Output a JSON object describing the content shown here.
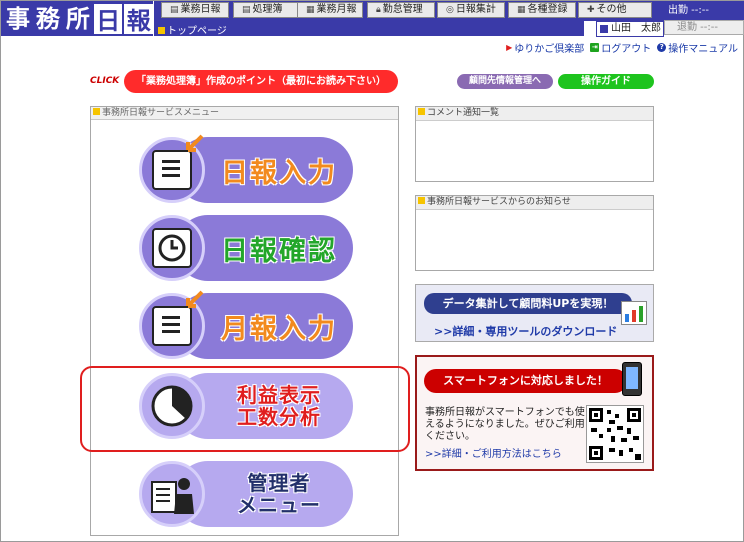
{
  "header": {
    "logo_chars": [
      "事",
      "務",
      "所",
      "日",
      "報"
    ],
    "nav": [
      {
        "icon": "list-icon",
        "label": "業務日報"
      },
      {
        "icon": "list-icon",
        "label": "処理簿"
      },
      {
        "icon": "calendar-icon",
        "label": "業務月報"
      },
      {
        "icon": "lock-icon",
        "label": "勤怠管理"
      },
      {
        "icon": "tally-icon",
        "label": "日報集計"
      },
      {
        "icon": "grid-icon",
        "label": "各種登録"
      },
      {
        "icon": "plus-icon",
        "label": "その他"
      }
    ],
    "breadcrumb": "トップページ",
    "clock_in": "出勤 --:--",
    "clock_out": "退勤 --:--",
    "user_name": "山田　太郎"
  },
  "links": {
    "cradle": "ゆりかご倶楽部",
    "logout": "ログアウト",
    "manual": "操作マニュアル"
  },
  "banner": {
    "click_tag": "CLICK",
    "points_text": "「業務処理簿」作成のポイント（最初にお読み下さい）",
    "client_mgmt": "顧問先情報管理へ",
    "guide": "操作ガイド"
  },
  "menu": {
    "title": "事務所日報サービスメニュー",
    "items": [
      {
        "label": "日報入力",
        "color": "#f28a1e"
      },
      {
        "label": "日報確認",
        "color": "#23a62a"
      },
      {
        "label": "月報入力",
        "color": "#f28a1e"
      },
      {
        "line1": "利益表示",
        "line2": "工数分析",
        "color": "#e01e1e"
      },
      {
        "line1": "管理者",
        "line2": "メニュー",
        "color": "#22306a"
      }
    ]
  },
  "right": {
    "comment_title": "コメント通知一覧",
    "notice_title": "事務所日報サービスからのお知らせ",
    "data_title": "データ集計して顧問料UPを実現！",
    "data_link": ">>詳細・専用ツールのダウンロード",
    "sp_title": "スマートフォンに対応しました！",
    "sp_text": "事務所日報がスマートフォンでも使えるようになりました。ぜひご利用ください。",
    "sp_link": ">>詳細・ご利用方法はこちら"
  },
  "colors": {
    "brand_navy": "#3a3aa8",
    "pill_purple": "#8b7ad8",
    "alert_red": "#e01e1e"
  }
}
